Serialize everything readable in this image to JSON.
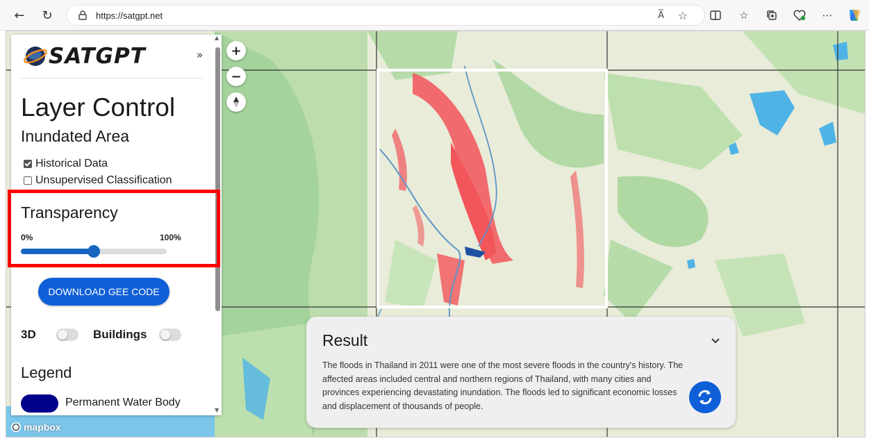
{
  "browser": {
    "back_icon": "back-arrow-icon",
    "reload_icon": "reload-icon",
    "url": "https://satgpt.net",
    "read_aloud": "A̅",
    "tools": [
      "split-screen-icon",
      "favorites-icon",
      "collections-icon",
      "health-icon",
      "more-icon",
      "copilot-icon"
    ],
    "more_label": "⋯"
  },
  "map": {
    "zoom_in": "+",
    "zoom_out": "−",
    "attribution": "mapbox",
    "colors": {
      "land": "#e8ecd9",
      "forest": "#a9d4a0",
      "water": "#4fb3e6",
      "flood": "#f2555a",
      "river": "#5d95c8",
      "grid": "#333333"
    }
  },
  "panel": {
    "logo_text": "SATGPT",
    "collapse": "»",
    "title": "Layer Control",
    "subtitle": "Inundated Area",
    "checkboxes": [
      {
        "label": "Historical Data",
        "checked": true
      },
      {
        "label": "Unsupervised Classification",
        "checked": false
      }
    ],
    "transparency": {
      "title": "Transparency",
      "min_label": "0%",
      "max_label": "100%",
      "value": 0.5
    },
    "download_button": "DOWNLOAD GEE CODE",
    "toggles": [
      {
        "label": "3D",
        "on": false
      },
      {
        "label": "Buildings",
        "on": false
      }
    ],
    "legend": {
      "title": "Legend",
      "items": [
        {
          "label": "Permanent Water Body",
          "color": "#00008b"
        }
      ]
    }
  },
  "result": {
    "title": "Result",
    "text": "The floods in Thailand in 2011 were one of the most severe floods in the country's history. The affected areas included central and northern regions of Thailand, with many cities and provinces experiencing devastating inundation. The floods led to significant economic losses and displacement of thousands of people."
  }
}
